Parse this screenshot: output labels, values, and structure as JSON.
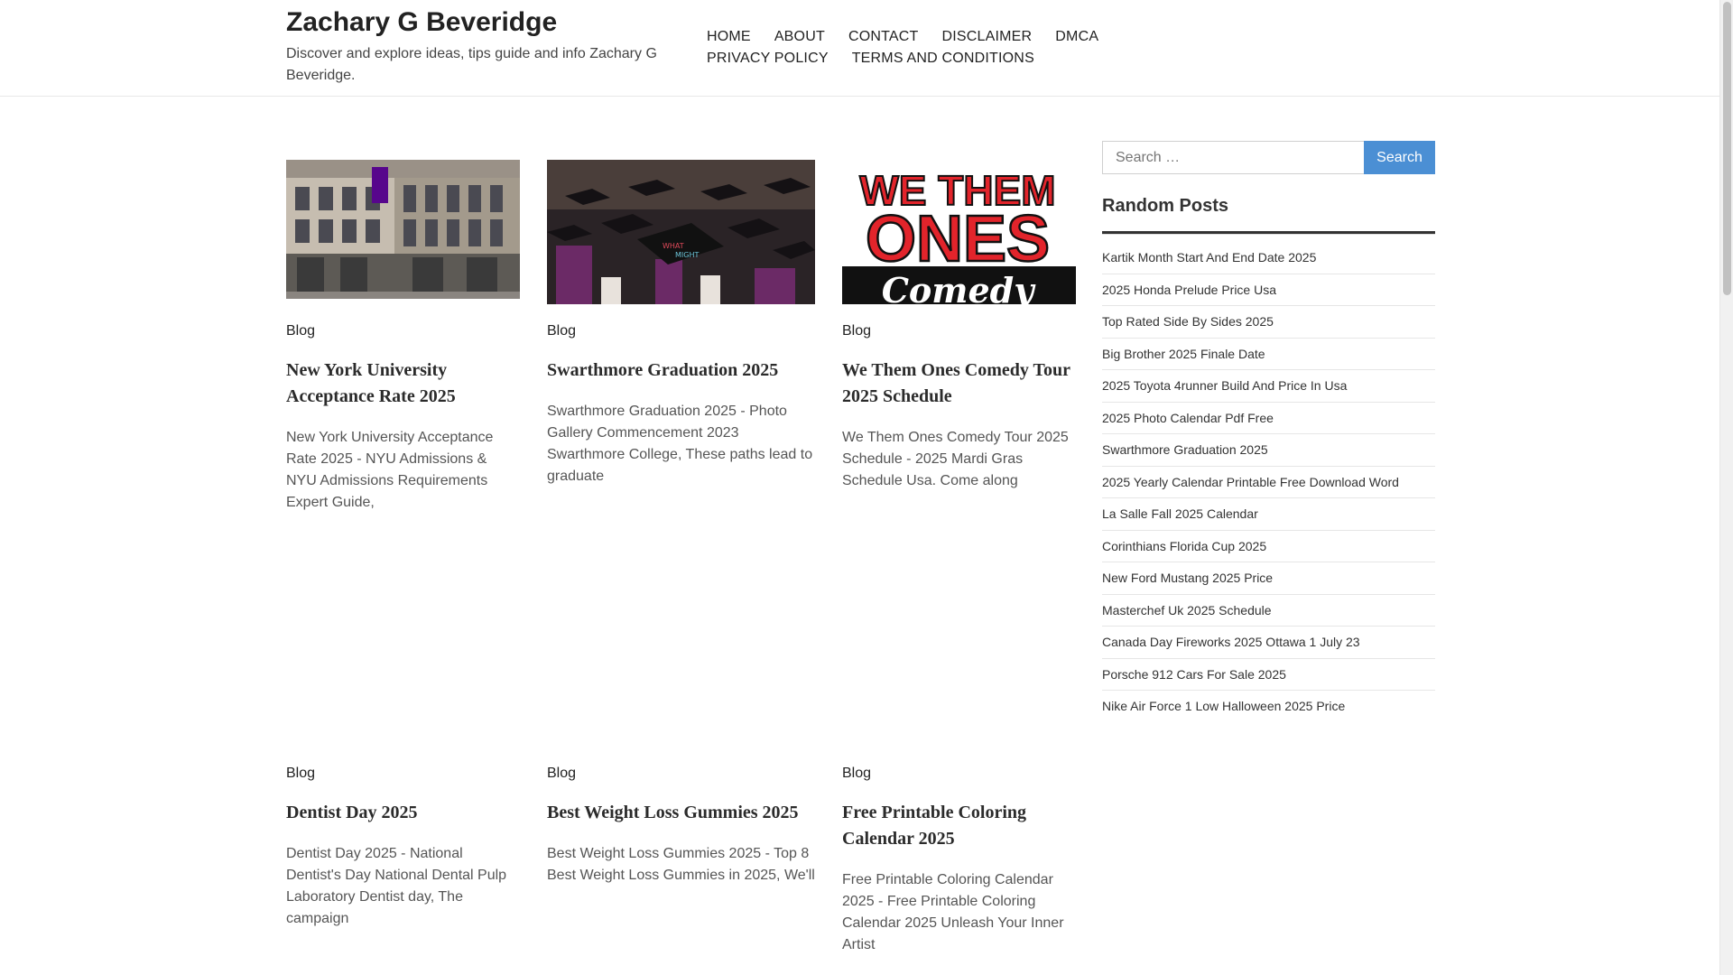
{
  "site": {
    "title": "Zachary G Beveridge",
    "description": "Discover and explore ideas, tips guide and info Zachary G Beveridge."
  },
  "nav": {
    "items": [
      {
        "label": "HOME"
      },
      {
        "label": "ABOUT"
      },
      {
        "label": "CONTACT"
      },
      {
        "label": "DISCLAIMER"
      },
      {
        "label": "DMCA"
      },
      {
        "label": "PRIVACY POLICY"
      },
      {
        "label": "TERMS AND CONDITIONS"
      }
    ]
  },
  "posts": [
    {
      "category": "Blog",
      "title": "New York University Acceptance Rate 2025",
      "excerpt": "New York University Acceptance Rate 2025 - NYU Admissions & NYU Admissions Requirements Expert Guide,",
      "image": "nyu-building-photo"
    },
    {
      "category": "Blog",
      "title": "Swarthmore Graduation 2025",
      "excerpt": "Swarthmore Graduation 2025 - Photo Gallery Commencement 2023 Swarthmore College, These paths lead to graduate",
      "image": "graduation-caps-photo"
    },
    {
      "category": "Blog",
      "title": "We Them Ones Comedy Tour 2025 Schedule",
      "excerpt": "We Them Ones Comedy Tour 2025 Schedule - 2025 Mardi Gras Schedule Usa. Come along",
      "image": "we-them-ones-comedy-logo",
      "image_text": {
        "line1": "WE THEM",
        "line2": "ONES",
        "line3": "Comedy"
      }
    },
    {
      "category": "Blog",
      "title": "Dentist Day 2025",
      "excerpt": "Dentist Day 2025 - National Dentist's Day National Dental Pulp Laboratory Dentist day, The campaign"
    },
    {
      "category": "Blog",
      "title": "Best Weight Loss Gummies 2025",
      "excerpt": "Best Weight Loss Gummies 2025 - Top 8 Best Weight Loss Gummies in 2025, We'll"
    },
    {
      "category": "Blog",
      "title": "Free Printable Coloring Calendar 2025",
      "excerpt": "Free Printable Coloring Calendar 2025 - Free Printable Coloring Calendar 2025 Unleash Your Inner Artist"
    }
  ],
  "sidebar": {
    "search": {
      "placeholder": "Search …",
      "button": "Search"
    },
    "random_posts": {
      "title": "Random Posts",
      "items": [
        "Kartik Month Start And End Date 2025",
        "2025 Honda Prelude Price Usa",
        "Top Rated Side By Sides 2025",
        "Big Brother 2025 Finale Date",
        "2025 Toyota 4runner Build And Price In Usa",
        "2025 Photo Calendar Pdf Free",
        "Swarthmore Graduation 2025",
        "2025 Yearly Calendar Printable Free Download Word",
        "La Salle Fall 2025 Calendar",
        "Corinthians Florida Cup 2025",
        "New Ford Mustang 2025 Price",
        "Masterchef Uk 2025 Schedule",
        "Canada Day Fireworks 2025 Ottawa 1 July 23",
        "Porsche 912 Cars For Sale 2025",
        "Nike Air Force 1 Low Halloween 2025 Price"
      ]
    }
  },
  "colors": {
    "accent": "#4b8fd4",
    "text": "#333333"
  }
}
